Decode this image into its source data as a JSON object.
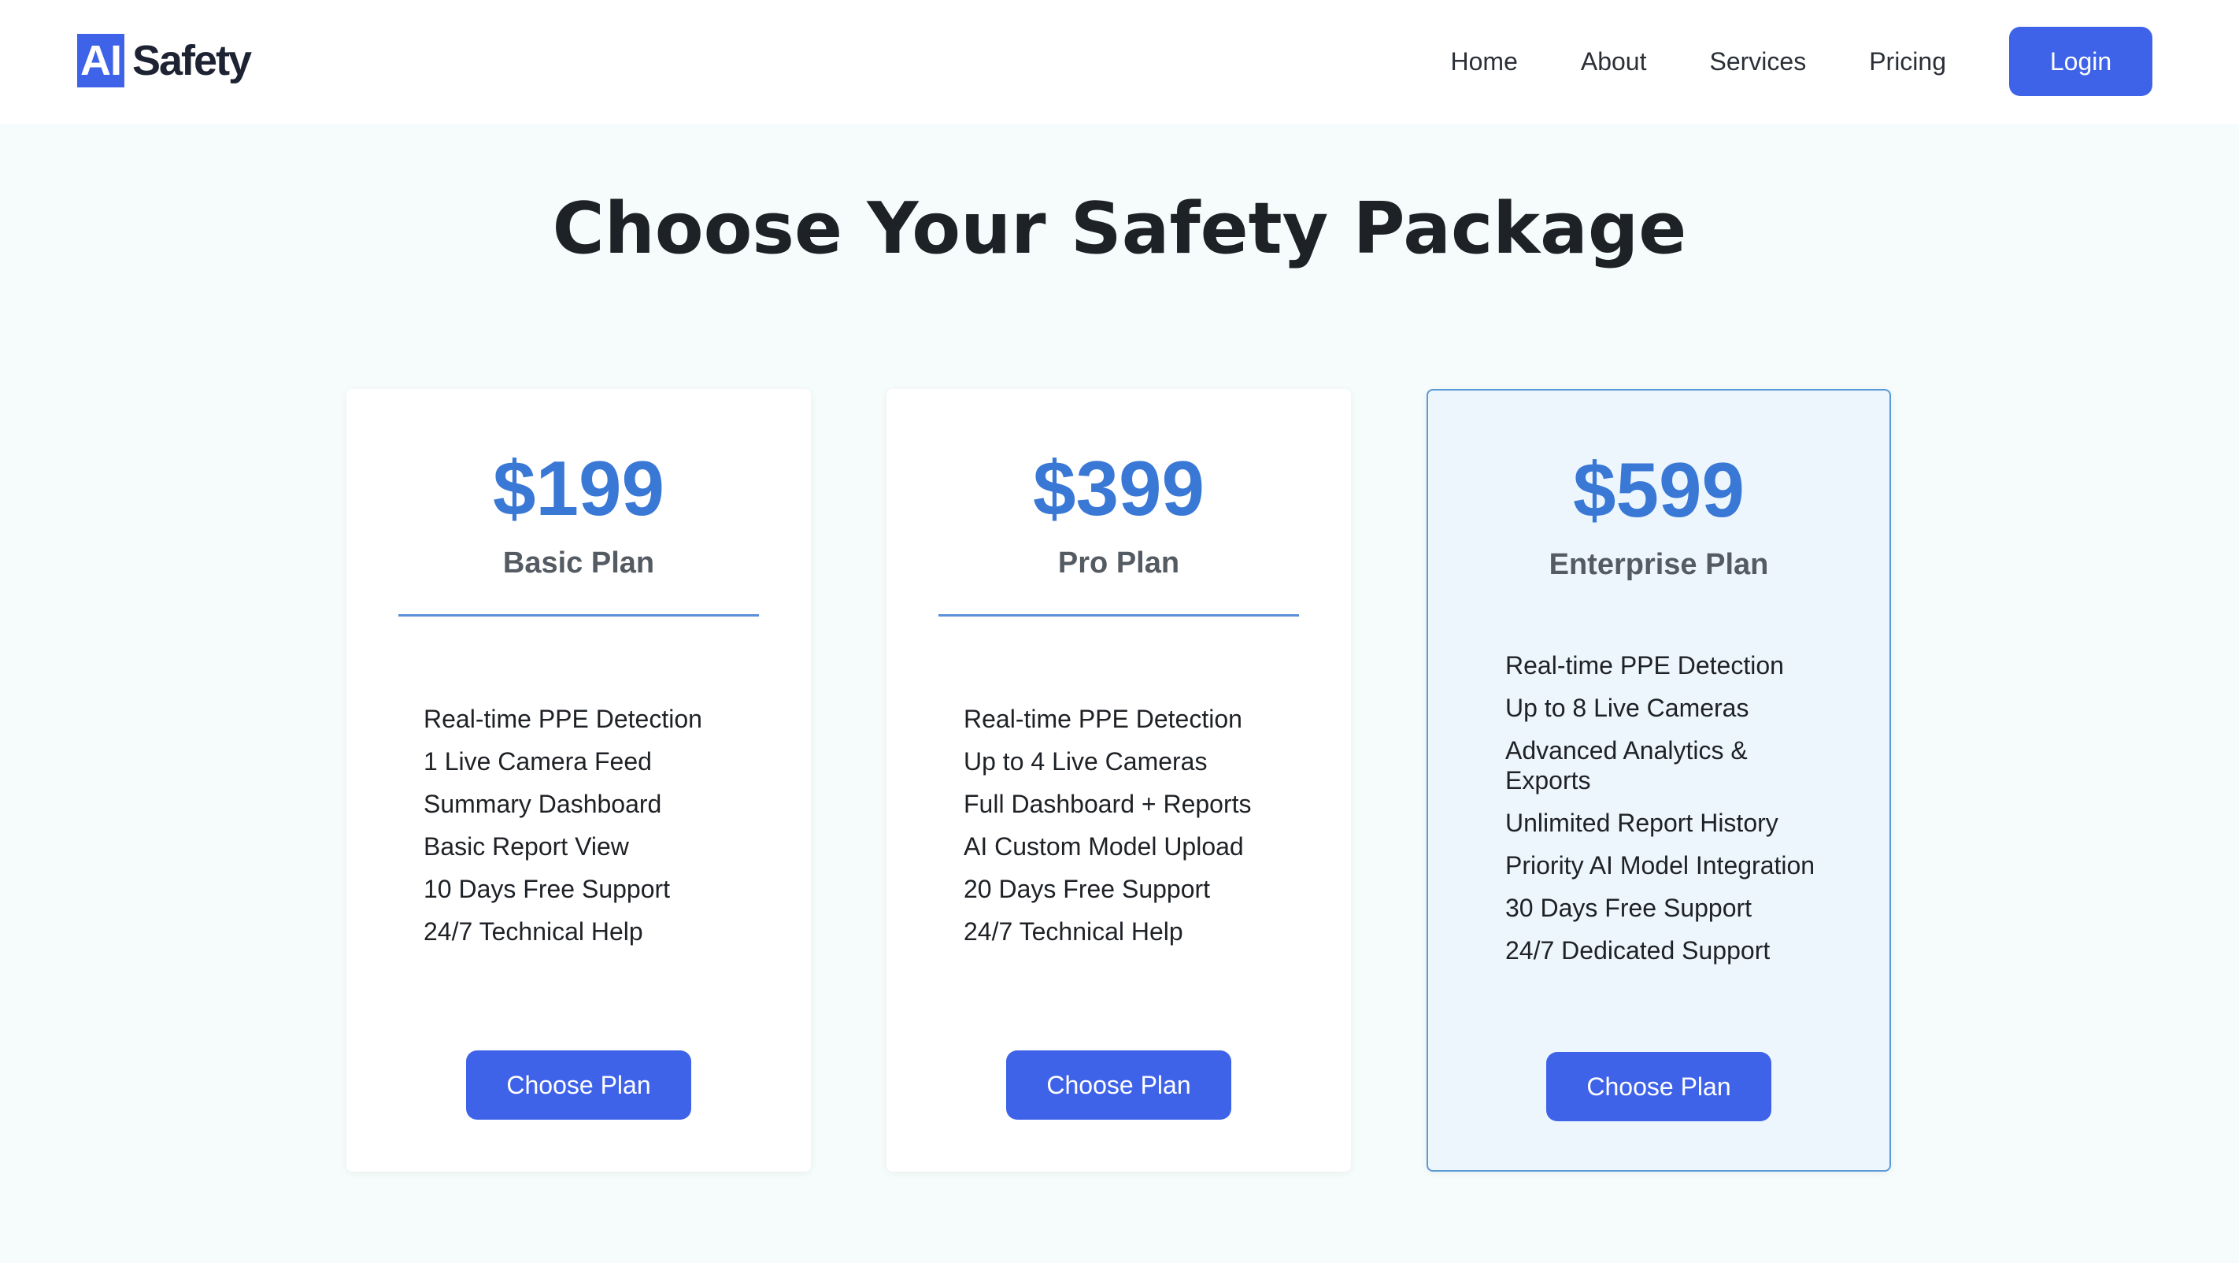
{
  "header": {
    "logo_badge": "AI",
    "logo_text": "Safety",
    "nav": [
      {
        "label": "Home"
      },
      {
        "label": "About"
      },
      {
        "label": "Services"
      },
      {
        "label": "Pricing"
      }
    ],
    "login_label": "Login"
  },
  "main": {
    "title": "Choose Your Safety Package",
    "plans": [
      {
        "price": "$199",
        "name": "Basic Plan",
        "featured": false,
        "features": [
          "Real-time PPE Detection",
          "1 Live Camera Feed",
          "Summary Dashboard",
          "Basic Report View",
          "10 Days Free Support",
          "24/7 Technical Help"
        ],
        "button_label": "Choose Plan"
      },
      {
        "price": "$399",
        "name": "Pro Plan",
        "featured": false,
        "features": [
          "Real-time PPE Detection",
          "Up to 4 Live Cameras",
          "Full Dashboard + Reports",
          "AI Custom Model Upload",
          "20 Days Free Support",
          "24/7 Technical Help"
        ],
        "button_label": "Choose Plan"
      },
      {
        "price": "$599",
        "name": "Enterprise Plan",
        "featured": true,
        "features": [
          "Real-time PPE Detection",
          "Up to 8 Live Cameras",
          "Advanced Analytics & Exports",
          "Unlimited Report History",
          "Priority AI Model Integration",
          "30 Days Free Support",
          "24/7 Dedicated Support"
        ],
        "button_label": "Choose Plan"
      }
    ]
  },
  "colors": {
    "accent": "#3f63e8",
    "price": "#3a78d6",
    "page_background": "#f6fcfb",
    "featured_background": "#eef6fd",
    "featured_border": "#5a9ad6"
  }
}
